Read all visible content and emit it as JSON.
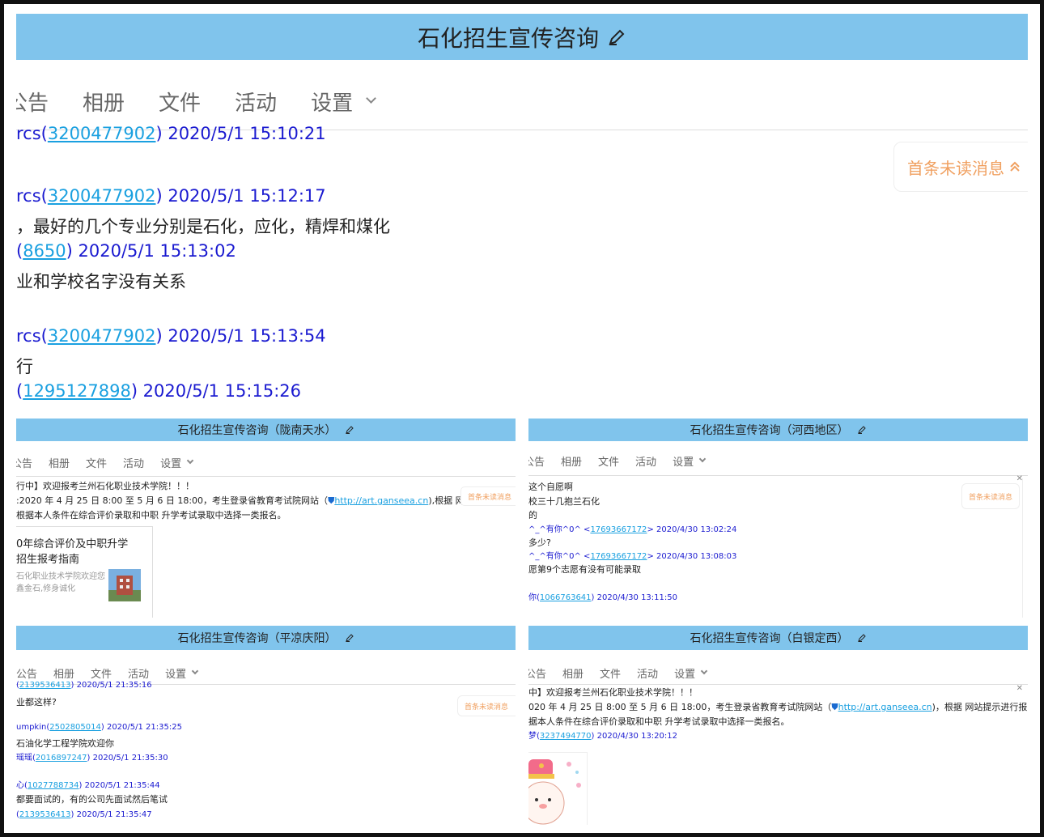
{
  "tabs": [
    "公告",
    "相册",
    "文件",
    "活动",
    "设置"
  ],
  "main": {
    "title": "石化招生宣传咨询",
    "unread": "首条未读消息",
    "messages": [
      {
        "kind": "meta",
        "name": "rcs",
        "qq": "3200477902",
        "time": "2020/5/1 15:10:21"
      },
      {
        "kind": "meta",
        "name": "rcs",
        "qq": "3200477902",
        "time": "2020/5/1 15:12:17"
      },
      {
        "kind": "text",
        "text": "，最好的几个专业分别是石化，应化，精焊和煤化"
      },
      {
        "kind": "meta",
        "name": "",
        "qq": "8650",
        "time": "2020/5/1 15:13:02"
      },
      {
        "kind": "text",
        "text": "业和学校名字没有关系"
      },
      {
        "kind": "meta",
        "name": "rcs",
        "qq": "3200477902",
        "time": "2020/5/1 15:13:54"
      },
      {
        "kind": "text",
        "text": "行"
      },
      {
        "kind": "meta",
        "name": "",
        "qq": "1295127898",
        "time": "2020/5/1 15:15:26"
      }
    ]
  },
  "longnan": {
    "title": "石化招生宣传咨询（陇南天水）",
    "unread": "首条未读消息",
    "lines": [
      "行中】欢迎报考兰州石化职业技术学院！！！",
      ":2020 年 4 月 25 日 8:00 至 5 月 6 日 18:00，考生登录省教育考试院网站（",
      "根据本人条件在综合评价录取和中职 升学考试录取中选择一类报名。"
    ],
    "link": "http://art.ganseea.cn",
    "link_suffix": "),根据 网站",
    "card": {
      "title1": "0年综合评价及中职升学",
      "title2": "招生报考指南",
      "desc1": "石化职业技术学院欢迎您",
      "desc2": "鑫金石,修身诚化"
    }
  },
  "hexi": {
    "title": "石化招生宣传咨询（河西地区）",
    "unread": "首条未读消息",
    "messages": [
      {
        "kind": "text",
        "text": "这个自愿啊"
      },
      {
        "kind": "text",
        "text": "校三十几抱兰石化"
      },
      {
        "kind": "text",
        "text": "的"
      },
      {
        "kind": "meta",
        "name": "^_^有你^0^ <",
        "qq": "17693667172",
        "close": ">",
        "time": "2020/4/30 13:02:24"
      },
      {
        "kind": "text",
        "text": "多少?"
      },
      {
        "kind": "meta",
        "name": "^_^有你^0^ <",
        "qq": "17693667172",
        "close": ">",
        "time": "2020/4/30 13:08:03"
      },
      {
        "kind": "text",
        "text": "愿第9个志愿有没有可能录取"
      },
      {
        "kind": "meta",
        "name": "你",
        "qq": "1066763641",
        "time": "2020/4/30 13:11:50"
      }
    ]
  },
  "pingliang": {
    "title": "石化招生宣传咨询（平凉庆阳）",
    "unread": "首条未读消息",
    "messages": [
      {
        "kind": "meta",
        "name": "",
        "qq": "2139536413",
        "time": "2020/5/1 21:35:16"
      },
      {
        "kind": "text",
        "text": "业都这样?"
      },
      {
        "kind": "meta",
        "name": "umpkin",
        "qq": "2502805014",
        "time": "2020/5/1 21:35:25"
      },
      {
        "kind": "text",
        "text": "石油化学工程学院欢迎你"
      },
      {
        "kind": "meta",
        "name": "瑶瑶",
        "qq": "2016897247",
        "time": "2020/5/1 21:35:30"
      },
      {
        "kind": "meta",
        "name": "心",
        "qq": "1027788734",
        "time": "2020/5/1 21:35:44"
      },
      {
        "kind": "text",
        "text": "都要面试的，有的公司先面试然后笔试"
      },
      {
        "kind": "meta",
        "name": "",
        "qq": "2139536413",
        "time": "2020/5/1 21:35:47"
      }
    ]
  },
  "baiyin": {
    "title": "石化招生宣传咨询（白银定西）",
    "lines": [
      "中】欢迎报考兰州石化职业技术学院！！！",
      "020 年 4 月 25 日 8:00 至 5 月 6 日 18:00，考生登录省教育考试院网站（",
      "据本人条件在综合评价录取和中职 升学考试录取中选择一类报名。"
    ],
    "link": "http://art.ganseea.cn",
    "link_suffix": ")，根据 网站提示进行报",
    "sender": {
      "name": "梦",
      "qq": "3237494770",
      "time": "2020/4/30 13:20:12"
    }
  }
}
